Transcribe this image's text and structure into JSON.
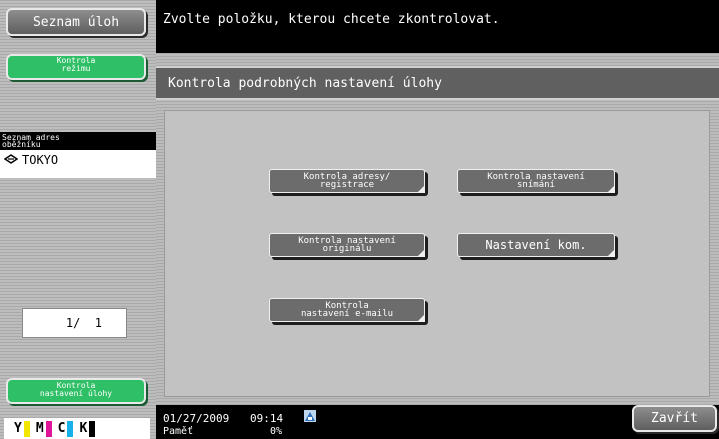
{
  "left_panel": {
    "job_list_button": "Seznam úloh",
    "mode_check_button": "Kontrola\nrežimu",
    "address_book_header": "Seznam adres\noběžníku",
    "address_item": "TOKYO",
    "page_indicator": "1/  1",
    "job_settings_check_button": "Kontrola\nnastavení úlohy",
    "toner": [
      {
        "label": "Y",
        "color": "#f2e600"
      },
      {
        "label": "M",
        "color": "#e0169a"
      },
      {
        "label": "C",
        "color": "#17b0e8"
      },
      {
        "label": "K",
        "color": "#000000"
      }
    ]
  },
  "message": "Zvolte položku, kterou chcete zkontrolovat.",
  "panel": {
    "title": "Kontrola podrobných nastavení úlohy",
    "buttons": {
      "address": "Kontrola adresy/\nregistrace",
      "scan": "Kontrola nastavení\nsnímání",
      "original": "Kontrola nastavení\noriginálu",
      "comm": "Nastavení kom.",
      "email": "Kontrola\nnastavení e-mailu"
    }
  },
  "status": {
    "date": "01/27/2009",
    "time": "09:14",
    "memory_label": "Paměť",
    "memory_value": "0%",
    "close_button": "Zavřít"
  }
}
